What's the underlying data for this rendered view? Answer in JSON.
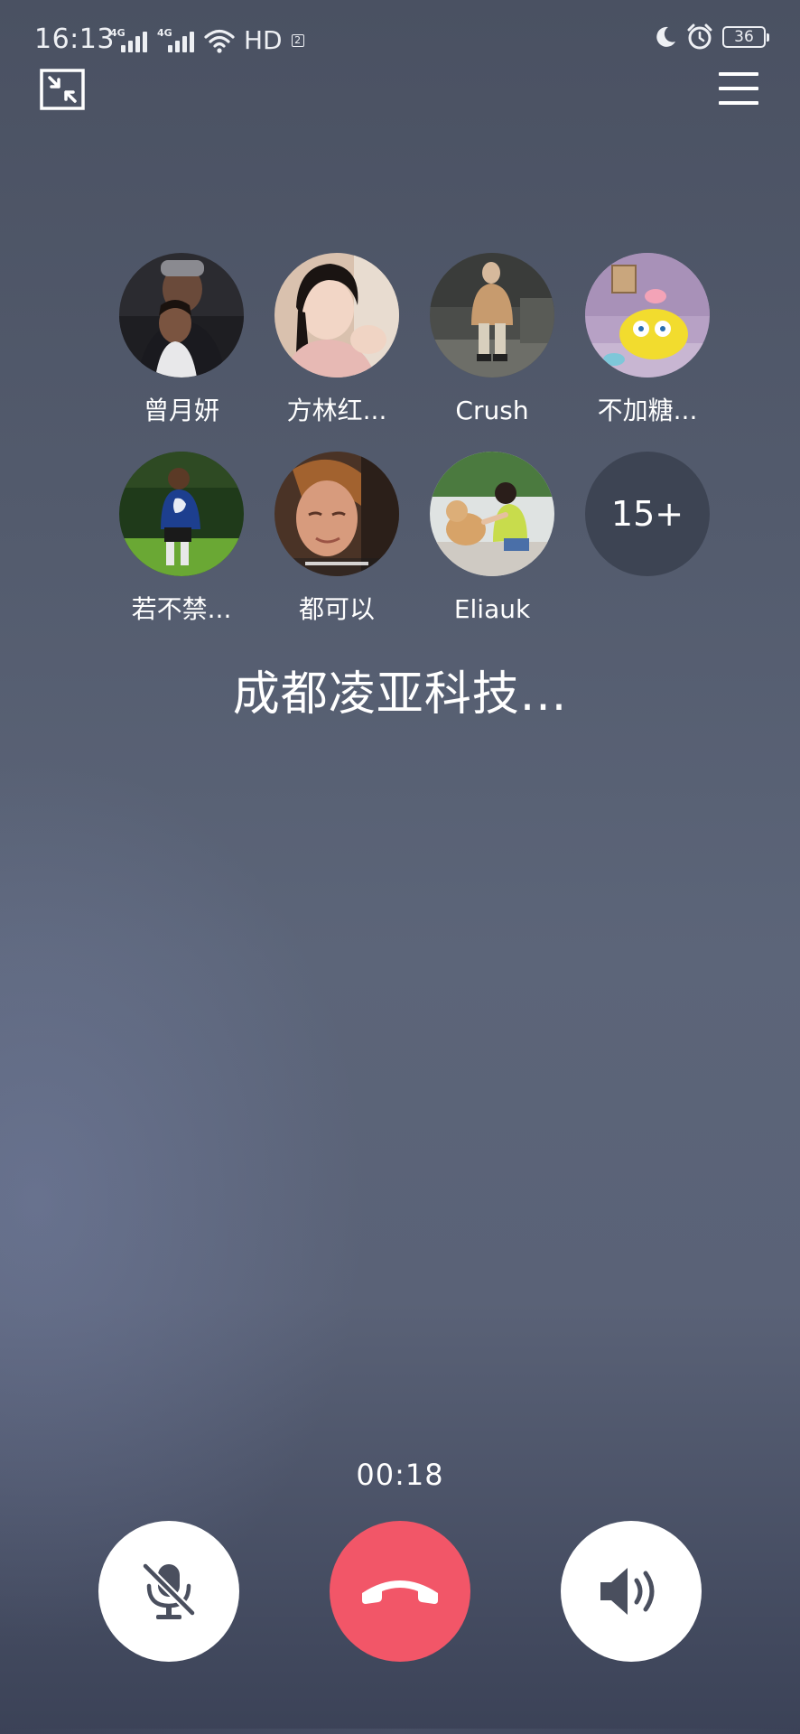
{
  "status_bar": {
    "time": "16:13",
    "signal_1_label": "4G",
    "signal_2_label": "4G",
    "hd_label": "HD",
    "hd_sub": "2",
    "battery": "36",
    "icons": [
      "signal-icon",
      "wifi-icon",
      "moon-icon",
      "alarm-icon",
      "battery-icon"
    ]
  },
  "top_bar": {
    "minimize_icon": "minimize-icon",
    "menu_icon": "menu-icon"
  },
  "participants": [
    {
      "name": "曾月妍"
    },
    {
      "name": "方林红..."
    },
    {
      "name": "Crush"
    },
    {
      "name": "不加糖..."
    },
    {
      "name": "若不禁..."
    },
    {
      "name": "都可以"
    },
    {
      "name": "Eliauk"
    }
  ],
  "more_count": "15+",
  "group_name": "成都凌亚科技...",
  "call": {
    "duration": "00:18",
    "mute_icon": "mic-off-icon",
    "hangup_icon": "hangup-icon",
    "speaker_icon": "speaker-icon",
    "hangup_color": "#f25668"
  }
}
